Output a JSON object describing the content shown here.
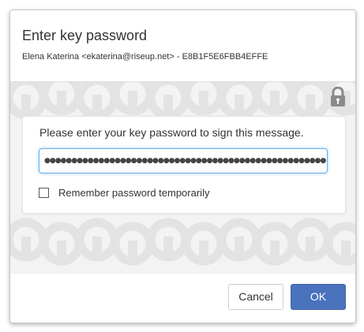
{
  "dialog": {
    "title": "Enter key password",
    "key_info": "Elena Katerina <ekaterina@riseup.net> - E8B1F5E6FBB4EFFE"
  },
  "form": {
    "prompt": "Please enter your key password to sign this message.",
    "password_value": "●●●●●●●●●●●●●●●●●●●●●●●●●●●●●●●●●●●●●●●●●●●●●●●●●●●●",
    "remember_label": "Remember password temporarily",
    "remember_checked": false
  },
  "buttons": {
    "cancel_label": "Cancel",
    "ok_label": "OK"
  },
  "icons": {
    "lock": "lock-icon",
    "background_pattern": "key-lock-pattern"
  },
  "colors": {
    "primary": "#4a72bd",
    "input_focus": "#66afe9",
    "body_background": "#f3f3f3"
  }
}
